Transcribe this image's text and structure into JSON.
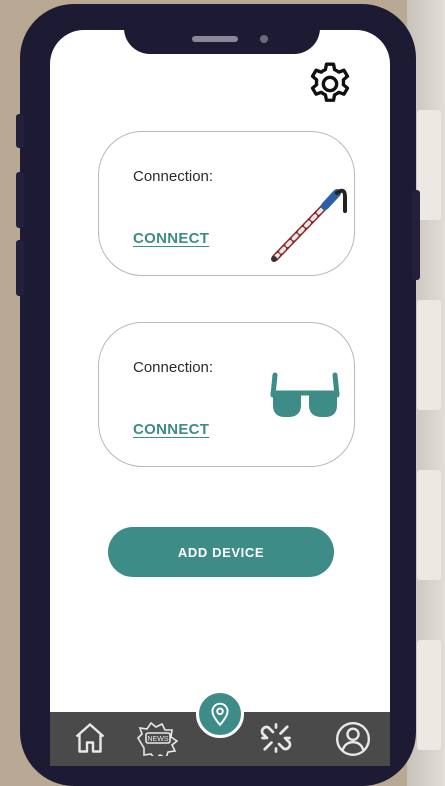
{
  "cards": [
    {
      "connection_label": "Connection:",
      "connect_label": "CONNECT",
      "device_icon": "cane-icon"
    },
    {
      "connection_label": "Connection:",
      "connect_label": "CONNECT",
      "device_icon": "glasses-icon"
    }
  ],
  "add_device_label": "ADD DEVICE",
  "nav": {
    "items": [
      "home-icon",
      "news-icon",
      "map-pin-icon",
      "broken-link-icon",
      "profile-icon"
    ],
    "news_badge": "NEWS"
  },
  "colors": {
    "accent": "#3d8c87",
    "navbar": "#4a4a4a",
    "phone_frame": "#1d1a33"
  }
}
